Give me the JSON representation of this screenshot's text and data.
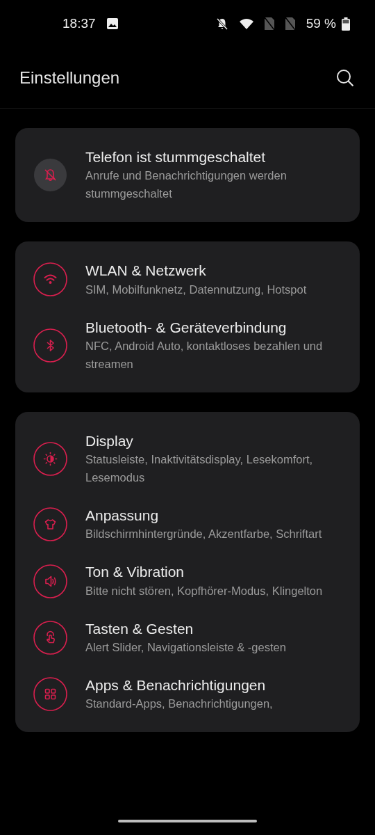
{
  "status_bar": {
    "time": "18:37",
    "battery": "59 %"
  },
  "header": {
    "title": "Einstellungen"
  },
  "groups": [
    {
      "items": [
        {
          "kind": "notice",
          "title": "Telefon ist stummgeschaltet",
          "subtitle": "Anrufe und Benachrichtigungen werden stummgeschaltet"
        }
      ]
    },
    {
      "items": [
        {
          "kind": "setting",
          "title": "WLAN & Netzwerk",
          "subtitle": "SIM, Mobilfunknetz, Datennutzung, Hotspot"
        },
        {
          "kind": "setting",
          "title": "Bluetooth- & Geräteverbindung",
          "subtitle": "NFC, Android Auto, kontaktloses bezahlen und streamen"
        }
      ]
    },
    {
      "items": [
        {
          "kind": "setting",
          "title": "Display",
          "subtitle": "Statusleiste, Inaktivitätsdisplay, Lesekomfort, Lesemodus"
        },
        {
          "kind": "setting",
          "title": "Anpassung",
          "subtitle": "Bildschirmhintergründe, Akzentfarbe, Schriftart"
        },
        {
          "kind": "setting",
          "title": "Ton & Vibration",
          "subtitle": "Bitte nicht stören, Kopfhörer-Modus, Klingelton"
        },
        {
          "kind": "setting",
          "title": "Tasten & Gesten",
          "subtitle": "Alert Slider, Navigationsleiste & -gesten"
        },
        {
          "kind": "setting",
          "title": "Apps & Benachrichtigungen",
          "subtitle": "Standard-Apps, Benachrichtigungen,"
        }
      ]
    }
  ]
}
